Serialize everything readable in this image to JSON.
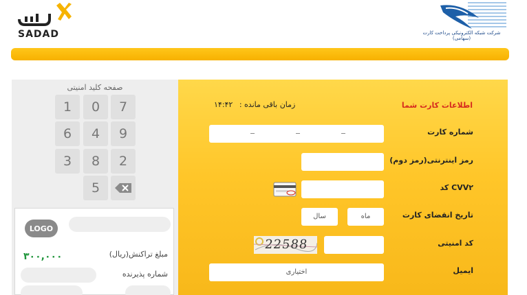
{
  "header": {
    "sadad_wordmark": "SADAD",
    "sadad_logo_text": "سداد",
    "shaparak_logo_text": "شاپرک",
    "shaparak_caption": "شرکت شبکه الکترونیکی پرداخت کارت (سهامی)"
  },
  "keypad": {
    "title": "صفحه کلید امنیتی",
    "keys": [
      "7",
      "0",
      "1",
      "9",
      "4",
      "6",
      "2",
      "8",
      "3",
      "5"
    ]
  },
  "receipt": {
    "logo": "LOGO",
    "amount": "۳۰۰,۰۰۰",
    "amount_label": "مبلغ تراکنش(ریال)",
    "merchant_label": "شماره پذیرنده"
  },
  "form": {
    "section_title": "اطلاعات کارت شما",
    "timer_label": "زمان باقی مانده :",
    "timer_value": "۱۴:۴۲",
    "card_number_label": "شماره کارت",
    "pin2_label": "رمز اینترنتی(رمز دوم)",
    "cvv2_label": "CVV۲ کد",
    "expiry_label": "تاریخ انقضای کارت",
    "month_placeholder": "ماه",
    "year_placeholder": "سال",
    "captcha_label": "کد امنیتی",
    "captcha_text": "22588",
    "email_label": "ایمیل",
    "email_placeholder": "اختیاری"
  },
  "colors": {
    "accent_yellow": "#ffc629",
    "title_red": "#d62a1e",
    "amount_green": "#20963c"
  }
}
